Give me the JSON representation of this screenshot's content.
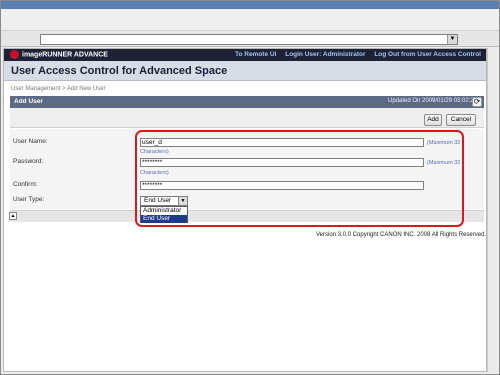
{
  "header": {
    "logo": "imageRUNNER ADVANCE",
    "links": [
      "To Remote UI",
      "Login User: Administrator",
      "Log Out from User Access Control"
    ]
  },
  "page": {
    "title": "User Access Control for Advanced Space",
    "breadcrumb": "User Management > Add New User"
  },
  "section": {
    "title": "Add User",
    "updated": "Updated On 2009/01/29 03:02:25"
  },
  "buttons": {
    "add": "Add",
    "cancel": "Cancel"
  },
  "form": {
    "user_name_label": "User Name:",
    "user_name_value": "user_d",
    "user_name_hint_a": "(Maximum 32",
    "user_name_hint_b": "Characters)",
    "password_label": "Password:",
    "password_value": "********",
    "password_hint_a": "(Maximum 32",
    "password_hint_b": "Characters)",
    "confirm_label": "Confirm:",
    "confirm_value": "********",
    "user_type_label": "User Type:",
    "user_type_selected": "End User",
    "user_type_options": [
      "Administrator",
      "End User"
    ]
  },
  "footer": {
    "copyright": "Version 3.0.0 Copyright CANON INC. 2008 All Rights Reserved."
  },
  "colors": {
    "header_bg": "#1f2235",
    "section_bar": "#5d6a86",
    "highlight": "#d61d1d",
    "selected_option": "#1f3a8c"
  }
}
